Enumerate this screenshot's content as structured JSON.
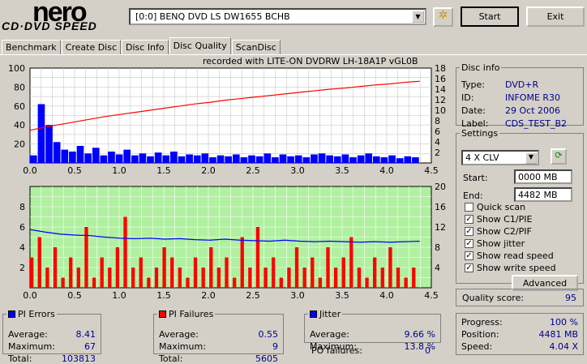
{
  "app": {
    "logo_top": "nero",
    "logo_bottom": "CD·DVD SPEED"
  },
  "toolbar": {
    "drive": "[0:0]  BENQ DVD LS DW1655 BCHB",
    "start": "Start",
    "exit": "Exit"
  },
  "tabs": [
    "Benchmark",
    "Create Disc",
    "Disc Info",
    "Disc Quality",
    "ScanDisc"
  ],
  "chart_title": "recorded with LITE-ON DVDRW LH-18A1P   vGL0B",
  "disc_info": {
    "title": "Disc info",
    "rows": [
      [
        "Type:",
        "DVD+R"
      ],
      [
        "ID:",
        "INFOME R30"
      ],
      [
        "Date:",
        "29 Oct 2006"
      ],
      [
        "Label:",
        "CDS_TEST_B2"
      ]
    ]
  },
  "settings": {
    "title": "Settings",
    "speed": "4 X CLV",
    "start_label": "Start:",
    "start": "0000 MB",
    "end_label": "End:",
    "end": "4482 MB",
    "checks": [
      [
        "Quick scan",
        false
      ],
      [
        "Show C1/PIE",
        true
      ],
      [
        "Show C2/PIF",
        true
      ],
      [
        "Show jitter",
        true
      ],
      [
        "Show read speed",
        true
      ],
      [
        "Show write speed",
        true
      ]
    ],
    "advanced": "Advanced"
  },
  "quality": {
    "label": "Quality score:",
    "value": "95"
  },
  "pi_errors": {
    "title": "PI Errors",
    "color": "#0000ff",
    "rows": [
      [
        "Average:",
        "8.41"
      ],
      [
        "Maximum:",
        "67"
      ],
      [
        "Total:",
        "103813"
      ]
    ]
  },
  "pi_failures": {
    "title": "PI Failures",
    "color": "#ff0000",
    "rows": [
      [
        "Average:",
        "0.55"
      ],
      [
        "Maximum:",
        "9"
      ],
      [
        "Total:",
        "5605"
      ]
    ]
  },
  "jitter": {
    "title": "Jitter",
    "color": "#0000ff",
    "rows": [
      [
        "Average:",
        "9.66 %"
      ],
      [
        "Maximum:",
        "13.8 %"
      ]
    ],
    "po_label": "PO failures:",
    "po": "0"
  },
  "progress": {
    "rows": [
      [
        "Progress:",
        "100 %"
      ],
      [
        "Position:",
        "4481 MB"
      ],
      [
        "Speed:",
        "4.04 X"
      ]
    ]
  },
  "chart_data": [
    {
      "type": "bar",
      "series": [
        {
          "values": [
            8,
            62,
            40,
            22,
            14,
            12,
            18,
            10,
            16,
            8,
            12,
            9,
            14,
            8,
            10,
            7,
            11,
            8,
            12,
            7,
            9,
            8,
            10,
            6,
            8,
            7,
            9,
            6,
            8,
            7,
            10,
            6,
            9,
            7,
            8,
            6,
            9,
            10,
            8,
            7,
            9,
            6,
            8,
            10,
            7,
            6,
            8,
            5,
            7,
            6
          ]
        },
        {
          "type": "line",
          "axis": "right",
          "values": [
            6.2,
            6.8,
            7.3,
            7.8,
            8.3,
            8.8,
            9.2,
            9.6,
            10,
            10.4,
            10.8,
            11.2,
            11.5,
            11.9,
            12.2,
            12.5,
            12.8,
            13.1,
            13.4,
            13.7,
            14,
            14.2,
            14.5,
            14.8,
            15,
            15.3,
            15.5
          ]
        }
      ],
      "xlim": [
        0,
        4.5
      ],
      "ylim": [
        0,
        100
      ],
      "y2lim": [
        0,
        18
      ],
      "xticks": [
        "0.0",
        "0.5",
        "1.0",
        "1.5",
        "2.0",
        "2.5",
        "3.0",
        "3.5",
        "4.0",
        "4.5"
      ],
      "yticks": [
        "20",
        "40",
        "60",
        "80",
        "100"
      ],
      "y2ticks": [
        "2",
        "4",
        "6",
        "8",
        "10",
        "12",
        "14",
        "16",
        "18"
      ]
    },
    {
      "type": "bar",
      "series": [
        {
          "values": [
            3,
            5,
            2,
            4,
            1,
            3,
            2,
            6,
            1,
            3,
            2,
            4,
            7,
            2,
            3,
            1,
            2,
            4,
            3,
            2,
            1,
            3,
            2,
            4,
            2,
            3,
            1,
            5,
            2,
            6,
            2,
            3,
            1,
            2,
            4,
            2,
            3,
            1,
            4,
            2,
            3,
            5,
            2,
            1,
            3,
            2,
            4,
            2,
            1,
            2
          ]
        },
        {
          "type": "line",
          "axis": "right",
          "values": [
            11.5,
            11,
            10.6,
            10.4,
            10.3,
            10,
            9.8,
            9.7,
            9.8,
            9.6,
            9.7,
            9.5,
            9.4,
            9.6,
            9.4,
            9.3,
            9.2,
            9.4,
            9.2,
            9.1,
            9.2,
            9.1,
            9,
            9.1,
            9,
            9.1,
            9.2
          ]
        }
      ],
      "xlim": [
        0,
        4.5
      ],
      "ylim": [
        0,
        10
      ],
      "y2lim": [
        0,
        20
      ],
      "xticks": [
        "0.0",
        "0.5",
        "1.0",
        "1.5",
        "2.0",
        "2.5",
        "3.0",
        "3.5",
        "4.0",
        "4.5"
      ],
      "yticks": [
        "2",
        "4",
        "6",
        "8"
      ],
      "y2ticks": [
        "4",
        "8",
        "12",
        "16",
        "20"
      ]
    }
  ]
}
